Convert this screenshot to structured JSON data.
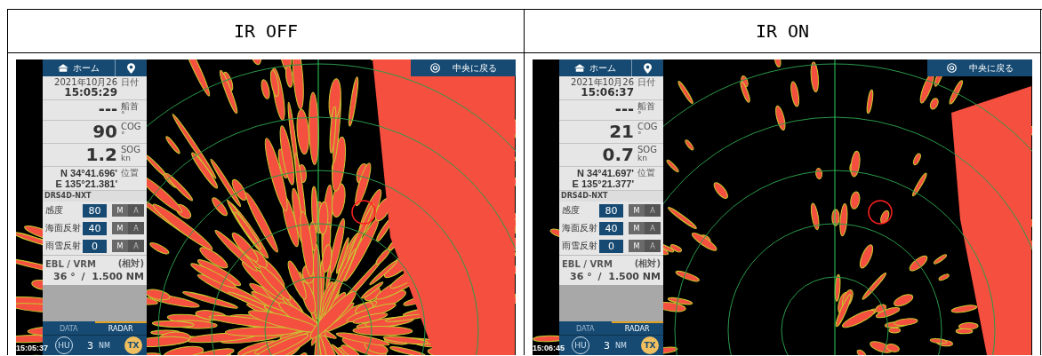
{
  "columns": [
    {
      "heading": "IR OFF",
      "screen": {
        "ir_on": false,
        "home_button": "ホーム",
        "center_button": "中央に戻る",
        "date": "2021年10月26",
        "date_label": "日付",
        "time": "15:05:29",
        "heading_value": "---",
        "heading_label": "船首",
        "heading_unit": "°",
        "cog_value": "90",
        "cog_label": "COG",
        "cog_unit": "°",
        "sog_value": "1.2",
        "sog_label": "SOG",
        "sog_unit": "kn",
        "latitude": "N 34°41.696'",
        "longitude": "E 135°21.381'",
        "position_label": "位置",
        "radar_model": "DRS4D-NXT",
        "gains": [
          {
            "label": "感度",
            "value": "80",
            "modes": [
              {
                "label": "M",
                "selected": true
              },
              {
                "label": "A",
                "selected": false
              }
            ]
          },
          {
            "label": "海面反射",
            "value": "40",
            "modes": [
              {
                "label": "M",
                "selected": true
              },
              {
                "label": "A",
                "selected": false
              }
            ]
          },
          {
            "label": "雨雪反射",
            "value": "0",
            "modes": [
              {
                "label": "M",
                "selected": true
              },
              {
                "label": "A",
                "selected": false
              }
            ]
          }
        ],
        "ebl_label": "EBL / VRM",
        "ebl_mode": "(相対)",
        "ebl_value": "36 °",
        "vrm_value": "/  1.500 NM",
        "tabs": [
          {
            "label": "DATA",
            "selected": false
          },
          {
            "label": "RADAR",
            "selected": true
          }
        ],
        "orientation": "HU",
        "range": "3",
        "range_unit": "NM",
        "tx": "TX",
        "timestamp": "15:05:37"
      }
    },
    {
      "heading": "IR ON",
      "screen": {
        "ir_on": true,
        "home_button": "ホーム",
        "center_button": "中央に戻る",
        "date": "2021年10月26",
        "date_label": "日付",
        "time": "15:06:37",
        "heading_value": "---",
        "heading_label": "船首",
        "heading_unit": "°",
        "cog_value": "21",
        "cog_label": "COG",
        "cog_unit": "°",
        "sog_value": "0.7",
        "sog_label": "SOG",
        "sog_unit": "kn",
        "latitude": "N 34°41.697'",
        "longitude": "E 135°21.377'",
        "position_label": "位置",
        "radar_model": "DRS4D-NXT",
        "gains": [
          {
            "label": "感度",
            "value": "80",
            "modes": [
              {
                "label": "M",
                "selected": true
              },
              {
                "label": "A",
                "selected": false
              }
            ]
          },
          {
            "label": "海面反射",
            "value": "40",
            "modes": [
              {
                "label": "M",
                "selected": true
              },
              {
                "label": "A",
                "selected": false
              }
            ]
          },
          {
            "label": "雨雪反射",
            "value": "0",
            "modes": [
              {
                "label": "M",
                "selected": true
              },
              {
                "label": "A",
                "selected": false
              }
            ]
          }
        ],
        "ebl_label": "EBL / VRM",
        "ebl_mode": "(相対)",
        "ebl_value": "36 °",
        "vrm_value": "/  1.500 NM",
        "tabs": [
          {
            "label": "DATA",
            "selected": false
          },
          {
            "label": "RADAR",
            "selected": true
          }
        ],
        "orientation": "HU",
        "range": "3",
        "range_unit": "NM",
        "tx": "TX",
        "timestamp": "15:06:45"
      }
    }
  ]
}
